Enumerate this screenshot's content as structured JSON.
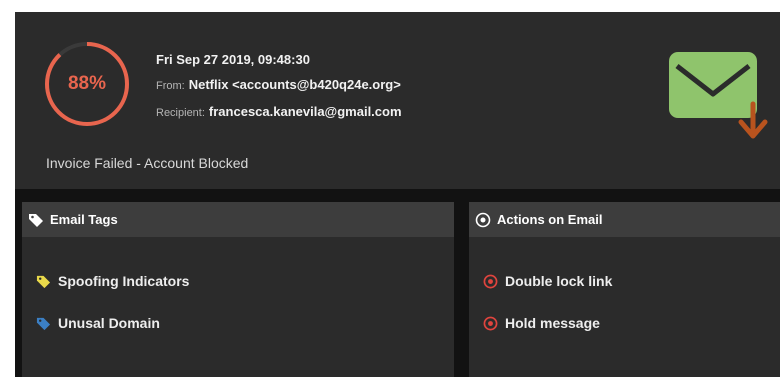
{
  "header": {
    "score_text": "88%",
    "score_value": 0.88,
    "date": "Fri Sep 27 2019, 09:48:30",
    "from_label": "From:",
    "from_value": "Netflix <accounts@b420q24e.org>",
    "recipient_label": "Recipient:",
    "recipient_value": "francesca.kanevila@gmail.com",
    "subject": "Invoice Failed - Account Blocked",
    "icon": "envelope-download-icon"
  },
  "tags_panel": {
    "title": "Email Tags",
    "icon": "tag-icon",
    "items": [
      {
        "label": "Spoofing Indicators",
        "icon": "tag-icon",
        "color": "#e9d94a"
      },
      {
        "label": "Unusal Domain",
        "icon": "tag-icon",
        "color": "#3b7fc4"
      }
    ]
  },
  "actions_panel": {
    "title": "Actions on Email",
    "icon": "target-icon",
    "items": [
      {
        "label": "Double lock link",
        "icon": "target-icon",
        "color": "#e0443e"
      },
      {
        "label": "Hold message",
        "icon": "target-icon",
        "color": "#e0443e"
      }
    ]
  },
  "colors": {
    "gauge_accent": "#e8654e",
    "envelope": "#8fc46c",
    "download_arrow": "#b8531e"
  }
}
